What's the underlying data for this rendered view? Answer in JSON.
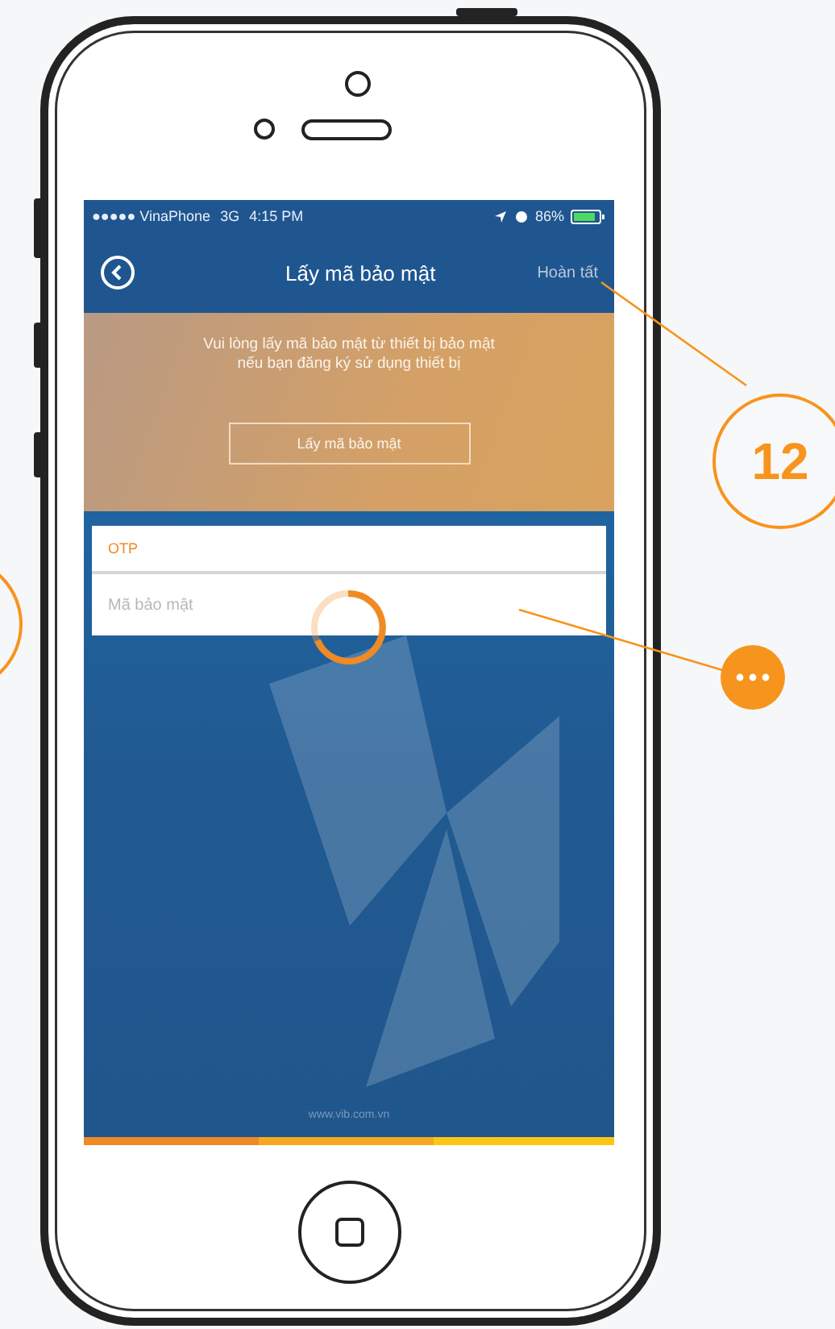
{
  "status_bar": {
    "carrier": "●●●●● VinaPhone",
    "network": "3G",
    "time": "4:15 PM",
    "battery": "86%"
  },
  "nav": {
    "title": "Lấy mã bảo mật",
    "action": "Hoàn tất"
  },
  "banner": {
    "message": "Vui lòng lấy mã bảo mật từ thiết bị bảo mật nếu bạn đăng ký sử dụng thiết bị",
    "button": "Lấy mã bảo mật"
  },
  "form": {
    "section_label": "OTP",
    "placeholder": "Mã bảo mật"
  },
  "footer": {
    "url": "www.vib.com.vn"
  },
  "callouts": [
    {
      "kind": "number",
      "label": "12"
    },
    {
      "kind": "more"
    }
  ]
}
